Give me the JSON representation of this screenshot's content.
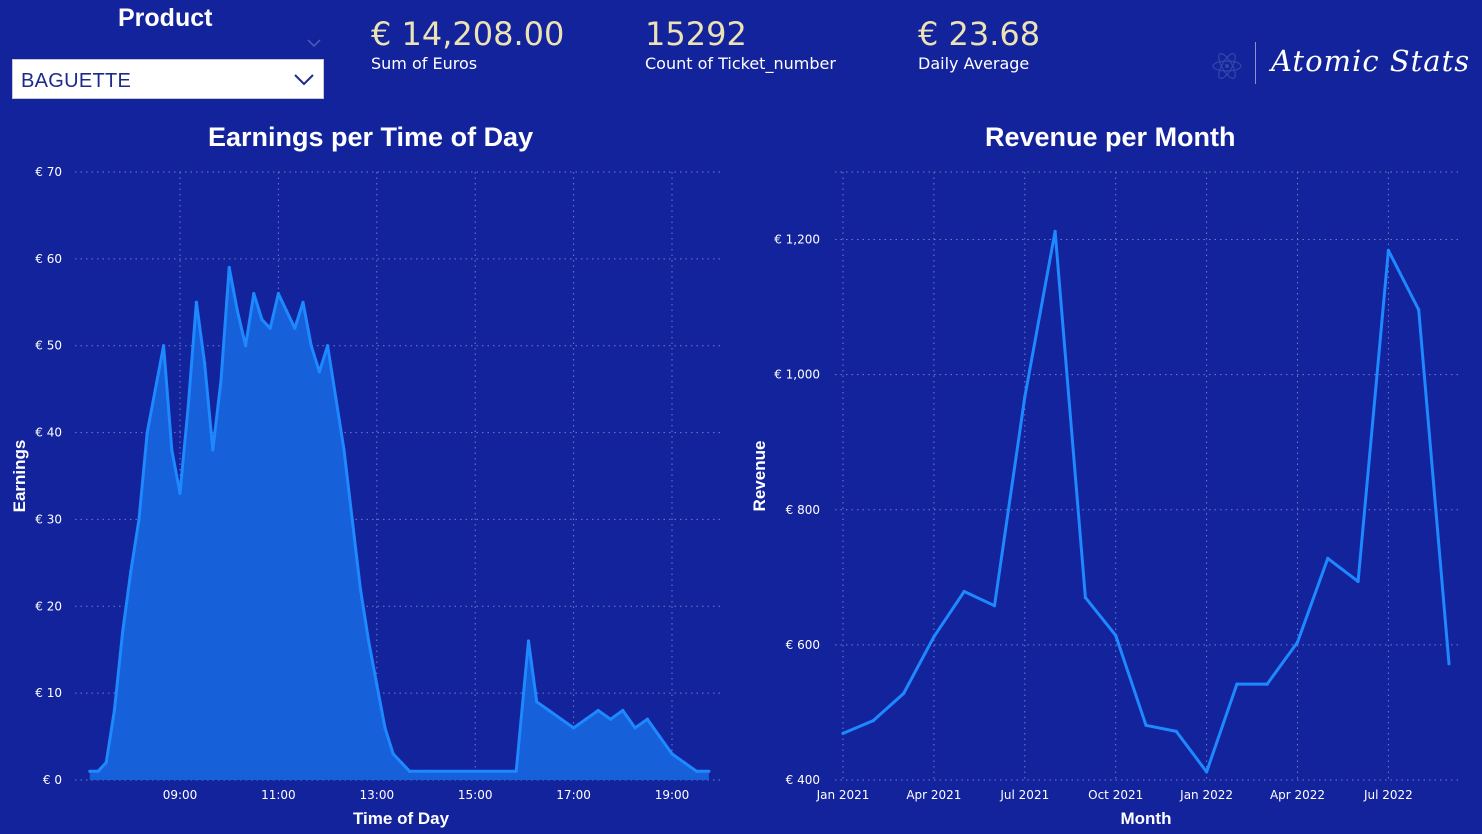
{
  "slicer": {
    "title": "Product",
    "selected": "BAGUETTE"
  },
  "kpis": [
    {
      "value": "€ 14,208.00",
      "label": "Sum of Euros"
    },
    {
      "value": "15292",
      "label": "Count of Ticket_number"
    },
    {
      "value": "€ 23.68",
      "label": "Daily Average"
    }
  ],
  "logo": {
    "text": "Atomic Stats",
    "icon": "atom-icon"
  },
  "colors": {
    "background": "#13239c",
    "line": "#1e88ff",
    "area": "#1660d9",
    "kpi_value": "#ece3b4"
  },
  "chart_data": [
    {
      "type": "area",
      "title": "Earnings per Time of Day",
      "xlabel": "Time of Day",
      "ylabel": "Earnings",
      "x_ticks": [
        "09:00",
        "11:00",
        "13:00",
        "15:00",
        "17:00",
        "19:00"
      ],
      "y_ticks": [
        "€ 0",
        "€ 10",
        "€ 20",
        "€ 30",
        "€ 40",
        "€ 50",
        "€ 60",
        "€ 70"
      ],
      "ylim": [
        0,
        70
      ],
      "xlim_hours": [
        7.0,
        20.0
      ],
      "grid": true,
      "series": [
        {
          "x": [
            "07:10",
            "07:20",
            "07:30",
            "07:40",
            "07:50",
            "08:00",
            "08:10",
            "08:20",
            "08:30",
            "08:40",
            "08:50",
            "09:00",
            "09:10",
            "09:20",
            "09:30",
            "09:40",
            "09:50",
            "10:00",
            "10:10",
            "10:20",
            "10:30",
            "10:40",
            "10:50",
            "11:00",
            "11:10",
            "11:20",
            "11:30",
            "11:40",
            "11:50",
            "12:00",
            "12:10",
            "12:20",
            "12:30",
            "12:40",
            "12:50",
            "13:00",
            "13:10",
            "13:20",
            "13:30",
            "13:40",
            "14:00",
            "15:50",
            "16:05",
            "16:15",
            "16:30",
            "16:45",
            "17:00",
            "17:15",
            "17:30",
            "17:45",
            "18:00",
            "18:15",
            "18:30",
            "18:45",
            "19:00",
            "19:15",
            "19:30",
            "19:45"
          ],
          "values": [
            1,
            1,
            2,
            8,
            17,
            24,
            30,
            40,
            45,
            50,
            38,
            33,
            43,
            55,
            48,
            38,
            46,
            59,
            54,
            50,
            56,
            53,
            52,
            56,
            54,
            52,
            55,
            50,
            47,
            50,
            44,
            38,
            30,
            22,
            16,
            11,
            6,
            3,
            2,
            1,
            1,
            1,
            16,
            9,
            8,
            7,
            6,
            7,
            8,
            7,
            8,
            6,
            7,
            5,
            3,
            2,
            1,
            1
          ]
        }
      ]
    },
    {
      "type": "line",
      "title": "Revenue per Month",
      "xlabel": "Month",
      "ylabel": "Revenue",
      "x_ticks": [
        "Jan 2021",
        "Apr 2021",
        "Jul 2021",
        "Oct 2021",
        "Jan 2022",
        "Apr 2022",
        "Jul 2022"
      ],
      "y_ticks": [
        "€ 400",
        "€ 600",
        "€ 800",
        "€ 1,000",
        "€ 1,200"
      ],
      "ylim": [
        400,
        1300
      ],
      "grid": true,
      "categories": [
        "2021-01",
        "2021-02",
        "2021-03",
        "2021-04",
        "2021-05",
        "2021-06",
        "2021-07",
        "2021-08",
        "2021-09",
        "2021-10",
        "2021-11",
        "2021-12",
        "2022-01",
        "2022-02",
        "2022-03",
        "2022-04",
        "2022-05",
        "2022-06",
        "2022-07",
        "2022-08",
        "2022-09"
      ],
      "values": [
        469,
        488,
        528,
        612,
        679,
        658,
        967,
        1212,
        670,
        614,
        481,
        472,
        412,
        542,
        542,
        604,
        728,
        694,
        1184,
        1096,
        572
      ]
    }
  ]
}
